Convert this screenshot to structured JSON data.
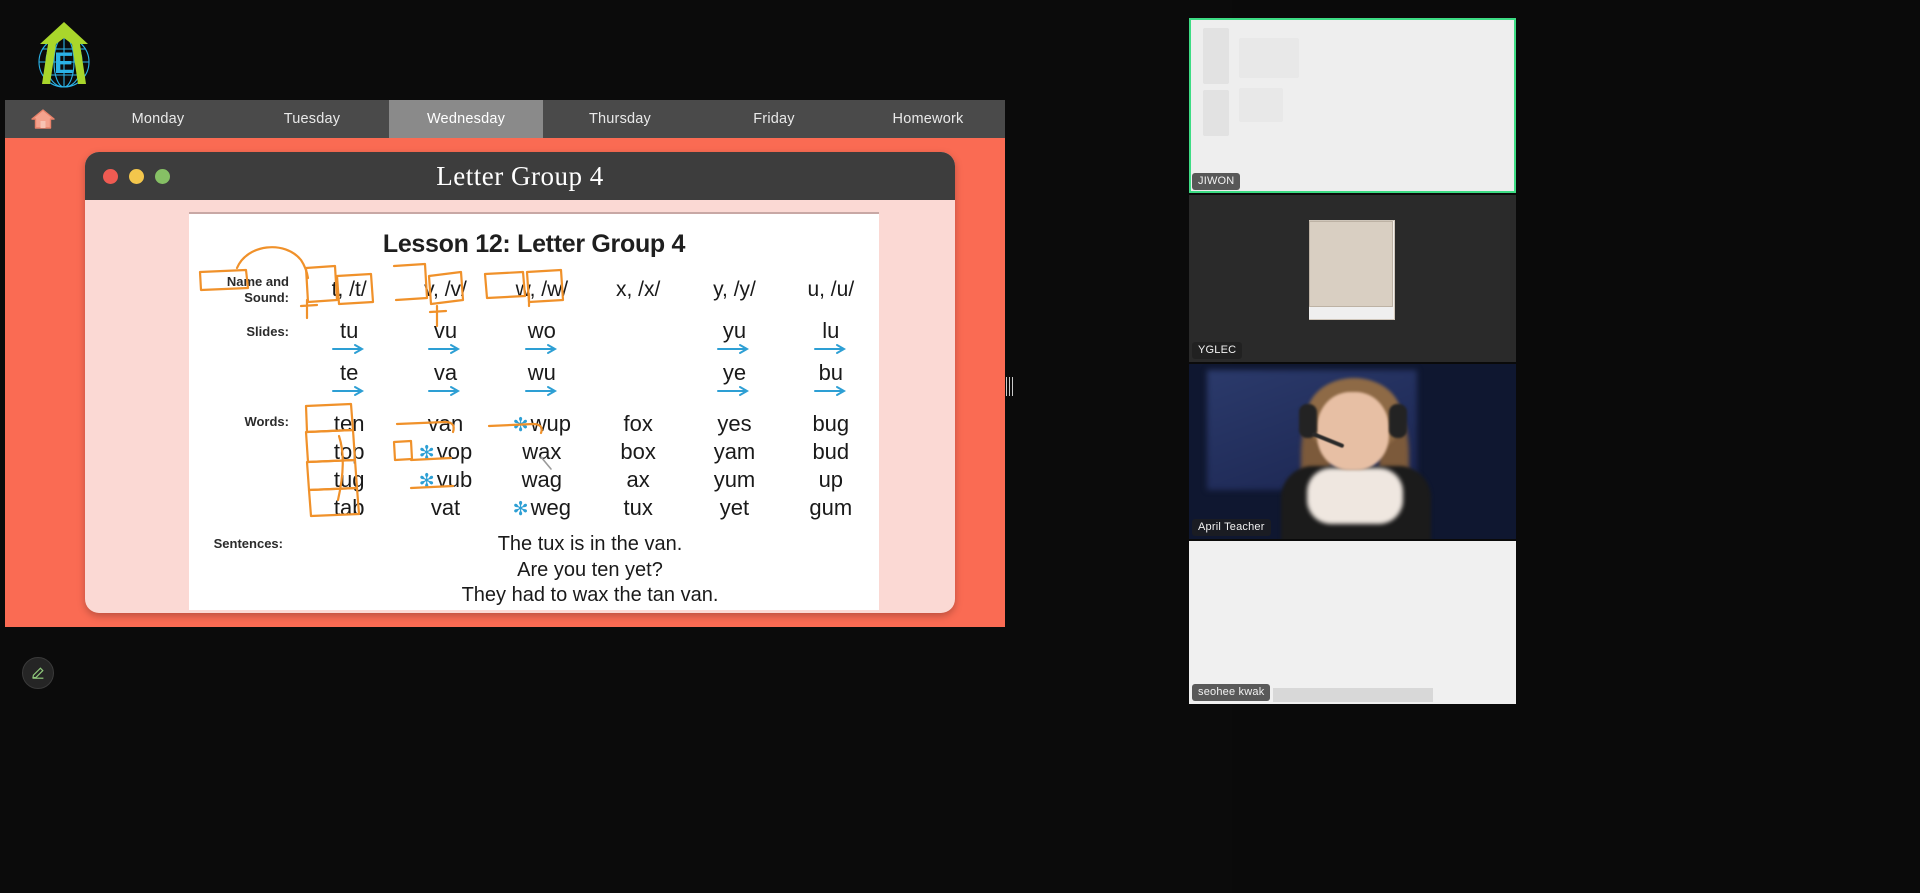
{
  "app": {
    "logo_alt": "education-globe-logo",
    "nav": {
      "home_icon": "home-icon",
      "tabs": [
        {
          "label": "Monday",
          "active": false
        },
        {
          "label": "Tuesday",
          "active": false
        },
        {
          "label": "Wednesday",
          "active": true
        },
        {
          "label": "Thursday",
          "active": false
        },
        {
          "label": "Friday",
          "active": false
        },
        {
          "label": "Homework",
          "active": false
        }
      ]
    },
    "annotate_icon": "pencil-edit-icon"
  },
  "card": {
    "title": "Letter Group 4",
    "window_dots": [
      "close-red",
      "minimize-yellow",
      "maximize-green"
    ]
  },
  "worksheet": {
    "title": "Lesson 12: Letter Group 4",
    "labels": {
      "name_sound": "Name and Sound:",
      "name_sound_line1": "Name and",
      "name_sound_line2": "Sound:",
      "slides": "Slides:",
      "words": "Words:",
      "sentences": "Sentences:"
    },
    "name_sound": [
      "t, /t/",
      "v, /v/",
      "w, /w/",
      "x, /x/",
      "y, /y/",
      "u, /u/"
    ],
    "slides": [
      [
        "tu",
        "vu",
        "wo",
        "",
        "yu",
        "lu"
      ],
      [
        "te",
        "va",
        "wu",
        "",
        "ye",
        "bu"
      ]
    ],
    "words": [
      [
        {
          "t": "ten"
        },
        {
          "t": "van"
        },
        {
          "t": "wup",
          "star": true
        },
        {
          "t": "fox"
        },
        {
          "t": "yes"
        },
        {
          "t": "bug"
        }
      ],
      [
        {
          "t": "top"
        },
        {
          "t": "vop",
          "star": true
        },
        {
          "t": "wax"
        },
        {
          "t": "box"
        },
        {
          "t": "yam"
        },
        {
          "t": "bud"
        }
      ],
      [
        {
          "t": "tug"
        },
        {
          "t": "vub",
          "star": true
        },
        {
          "t": "wag"
        },
        {
          "t": "ax"
        },
        {
          "t": "yum"
        },
        {
          "t": "up"
        }
      ],
      [
        {
          "t": "tab"
        },
        {
          "t": "vat"
        },
        {
          "t": "weg",
          "star": true
        },
        {
          "t": "tux"
        },
        {
          "t": "yet"
        },
        {
          "t": "gum"
        }
      ]
    ],
    "sentences": [
      "The tux is in the van.",
      "Are you ten yet?",
      "They had to wax the tan van."
    ],
    "colors": {
      "ink": "#f0912a",
      "arrow": "#2d9fd4",
      "star": "#2d9fd4",
      "stage": "#fa6b53",
      "card": "#fbd9d4"
    }
  },
  "roster": [
    {
      "name": "JIWON",
      "active": true
    },
    {
      "name": "YGLEC",
      "active": false
    },
    {
      "name": "April Teacher",
      "active": false
    },
    {
      "name": "seohee kwak",
      "active": false
    }
  ]
}
